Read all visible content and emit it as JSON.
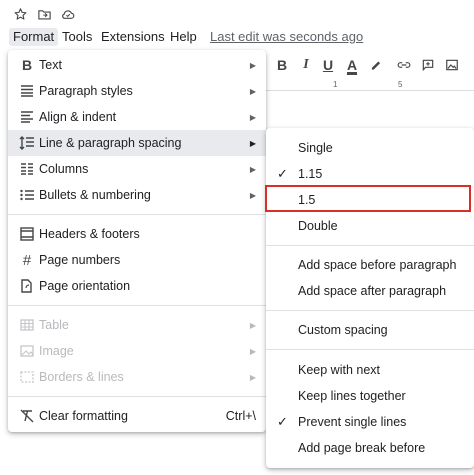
{
  "menubar": {
    "items": [
      {
        "label": "Format",
        "active": true
      },
      {
        "label": "Tools"
      },
      {
        "label": "Extensions"
      },
      {
        "label": "Help"
      }
    ],
    "last_edit": "Last edit was seconds ago"
  },
  "top_icons": [
    "star-icon",
    "move-to-folder-icon",
    "cloud-status-icon"
  ],
  "toolbar": {
    "bold": "B",
    "italic": "I",
    "underline": "U",
    "text_color": "A",
    "ruler_ticks": [
      "1",
      "5"
    ]
  },
  "format_menu": {
    "items": [
      {
        "icon": "bold-icon",
        "glyph": "B",
        "label": "Text",
        "submenu": true
      },
      {
        "icon": "paragraph-styles-icon",
        "label": "Paragraph styles",
        "submenu": true
      },
      {
        "icon": "align-indent-icon",
        "label": "Align & indent",
        "submenu": true
      },
      {
        "icon": "line-spacing-icon",
        "label": "Line & paragraph spacing",
        "submenu": true,
        "highlighted": true
      },
      {
        "icon": "columns-icon",
        "label": "Columns",
        "submenu": true
      },
      {
        "icon": "bullets-icon",
        "label": "Bullets & numbering",
        "submenu": true
      },
      {
        "icon": "headers-footers-icon",
        "label": "Headers & footers"
      },
      {
        "icon": "page-numbers-icon",
        "glyph": "#",
        "label": "Page numbers"
      },
      {
        "icon": "page-orientation-icon",
        "label": "Page orientation"
      },
      {
        "icon": "table-icon",
        "label": "Table",
        "submenu": true,
        "disabled": true
      },
      {
        "icon": "image-icon",
        "label": "Image",
        "submenu": true,
        "disabled": true
      },
      {
        "icon": "borders-lines-icon",
        "label": "Borders & lines",
        "submenu": true,
        "disabled": true
      },
      {
        "icon": "clear-formatting-icon",
        "label": "Clear formatting",
        "shortcut": "Ctrl+\\"
      }
    ]
  },
  "spacing_submenu": {
    "items": [
      {
        "label": "Single",
        "checked": false
      },
      {
        "label": "1.15",
        "checked": true
      },
      {
        "label": "1.5",
        "checked": false,
        "boxed": true
      },
      {
        "label": "Double",
        "checked": false
      },
      {
        "label": "Add space before paragraph"
      },
      {
        "label": "Add space after paragraph"
      },
      {
        "label": "Custom spacing"
      },
      {
        "label": "Keep with next"
      },
      {
        "label": "Keep lines together"
      },
      {
        "label": "Prevent single lines",
        "checked": true
      },
      {
        "label": "Add page break before"
      }
    ],
    "check_glyph": "✓",
    "highlight_color": "#d93025"
  }
}
